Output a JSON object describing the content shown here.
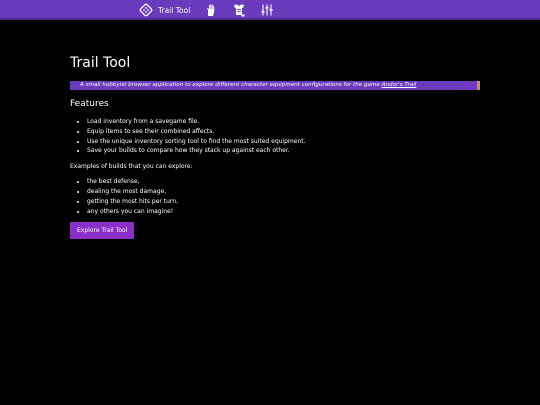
{
  "nav": {
    "brand_label": "Trail Tool",
    "icons": [
      "dice-logo-icon",
      "hand-icon",
      "armor-icon",
      "sliders-icon"
    ]
  },
  "main": {
    "title": "Trail Tool",
    "tagline_text": "A small hobbyist browser application to explore different character equipment configurations for the game ",
    "tagline_link": "Andor's Trail",
    "features_heading": "Features",
    "features": [
      "Load inventory from a savegame file.",
      "Equip items to see their combined affects.",
      "Use the unique inventory sorting tool to find the most suited equipment.",
      "Save your builds to compare how they stack up against each other."
    ],
    "examples_intro": "Examples of builds that you can explore:",
    "examples": [
      "the best defense,",
      "dealing the most damage,",
      "getting the most hits per turn,",
      "any others you can imagine!"
    ],
    "explore_button": "Explore Trail Tool"
  },
  "colors": {
    "topbar": "#6a3bbd",
    "tagline_bg": "#6a3bbd",
    "tagline_accent": "#e08a2e",
    "button": "#8a2fc8",
    "background": "#000000"
  }
}
